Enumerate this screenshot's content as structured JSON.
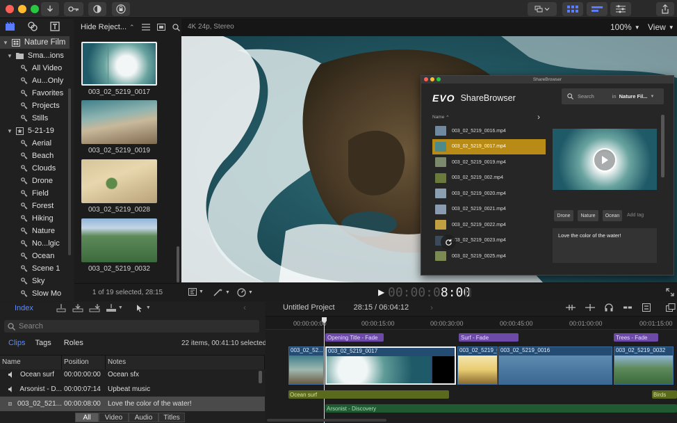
{
  "libraries": {
    "library_name": "Nature Film",
    "items": [
      {
        "label": "Sma...ions",
        "indent": 1,
        "type": "folder"
      },
      {
        "label": "All Video",
        "indent": 2,
        "type": "keyword"
      },
      {
        "label": "Au...Only",
        "indent": 2,
        "type": "keyword"
      },
      {
        "label": "Favorites",
        "indent": 2,
        "type": "keyword"
      },
      {
        "label": "Projects",
        "indent": 2,
        "type": "keyword"
      },
      {
        "label": "Stills",
        "indent": 2,
        "type": "keyword"
      },
      {
        "label": "5-21-19",
        "indent": 1,
        "type": "event"
      },
      {
        "label": "Aerial",
        "indent": 2,
        "type": "keyword"
      },
      {
        "label": "Beach",
        "indent": 2,
        "type": "keyword"
      },
      {
        "label": "Clouds",
        "indent": 2,
        "type": "keyword"
      },
      {
        "label": "Drone",
        "indent": 2,
        "type": "keyword"
      },
      {
        "label": "Field",
        "indent": 2,
        "type": "keyword"
      },
      {
        "label": "Forest",
        "indent": 2,
        "type": "keyword"
      },
      {
        "label": "Hiking",
        "indent": 2,
        "type": "keyword"
      },
      {
        "label": "Nature",
        "indent": 2,
        "type": "keyword"
      },
      {
        "label": "No...lgic",
        "indent": 2,
        "type": "keyword"
      },
      {
        "label": "Ocean",
        "indent": 2,
        "type": "keyword"
      },
      {
        "label": "Scene 1",
        "indent": 2,
        "type": "keyword"
      },
      {
        "label": "Sky",
        "indent": 2,
        "type": "keyword"
      },
      {
        "label": "Slow Mo",
        "indent": 2,
        "type": "keyword"
      }
    ]
  },
  "browser": {
    "filter_label": "Hide Reject...",
    "clips": [
      {
        "name": "003_02_5219_0017",
        "selected": true
      },
      {
        "name": "003_02_5219_0019",
        "selected": false
      },
      {
        "name": "003_02_5219_0028",
        "selected": false
      },
      {
        "name": "003_02_5219_0032",
        "selected": false
      }
    ],
    "status": "1 of 19 selected, 28:15"
  },
  "viewer": {
    "format": "4K 24p, Stereo",
    "zoom": "100%",
    "view_label": "View",
    "timecode_dim": "00:00:0",
    "timecode_bright": "8:00"
  },
  "sharebrowser": {
    "window_title": "ShareBrowser",
    "logo_text": "EVO",
    "app_name": "ShareBrowser",
    "search_placeholder": "Search",
    "search_in": "in",
    "search_scope": "Nature Fil...",
    "column_header": "Name",
    "files": [
      {
        "name": "003_02_5219_0016.mp4",
        "selected": false,
        "color": "#6f8aa0"
      },
      {
        "name": "003_02_5219_0017.mp4",
        "selected": true,
        "color": "#4d8a8a"
      },
      {
        "name": "003_02_5219_0019.mp4",
        "selected": false,
        "color": "#7a8a6a"
      },
      {
        "name": "003_02_5219_002.mp4",
        "selected": false,
        "color": "#6a7a3a"
      },
      {
        "name": "003_02_5219_0020.mp4",
        "selected": false,
        "color": "#8aa0b0"
      },
      {
        "name": "003_02_5219_0021.mp4",
        "selected": false,
        "color": "#8a9ab0"
      },
      {
        "name": "003_02_5219_0022.mp4",
        "selected": false,
        "color": "#c0a040"
      },
      {
        "name": "003_02_5219_0023.mp4",
        "selected": false,
        "color": "#3a4a5a"
      },
      {
        "name": "003_02_5219_0025.mp4",
        "selected": false,
        "color": "#7a8a50"
      }
    ],
    "tags": [
      "Drone",
      "Nature",
      "Ocean"
    ],
    "add_tag_placeholder": "Add tag",
    "comment": "Love the color of the water!"
  },
  "index": {
    "tab_label": "Index",
    "search_placeholder": "Search",
    "tabs": [
      "Clips",
      "Tags",
      "Roles"
    ],
    "active_tab": "Clips",
    "summary": "22 items, 00:41:10 selected",
    "columns": [
      "Name",
      "Position",
      "Notes"
    ],
    "rows": [
      {
        "name": "Ocean surf",
        "position": "00:00:00:00",
        "notes": "Ocean sfx",
        "icon": "audio",
        "selected": false
      },
      {
        "name": "Arsonist - D...",
        "position": "00:00:07:14",
        "notes": "Upbeat music",
        "icon": "audio",
        "selected": false
      },
      {
        "name": "003_02_521...",
        "position": "00:00:08:00",
        "notes": "Love the color of the water!",
        "icon": "video",
        "selected": true
      }
    ],
    "filters": [
      "All",
      "Video",
      "Audio",
      "Titles"
    ],
    "active_filter": "All"
  },
  "timeline": {
    "project_name": "Untitled Project",
    "durations": "28:15 / 06:04:12",
    "ruler": [
      "00:00:00:00",
      "00:00:15:00",
      "00:00:30:00",
      "00:00:45:00",
      "00:01:00:00",
      "00:01:15:00"
    ],
    "titles": [
      "Opening Title - Fade",
      "Surf - Fade",
      "Trees - Fade"
    ],
    "video_clips": [
      "003_02_52...",
      "003_02_5219_0017",
      "003_02_5219_0...",
      "003_02_5219_0016",
      "003_02_5219_0032"
    ],
    "audio_clips": [
      "Ocean surf",
      "Arsonist - Discovery",
      "Birds"
    ]
  }
}
